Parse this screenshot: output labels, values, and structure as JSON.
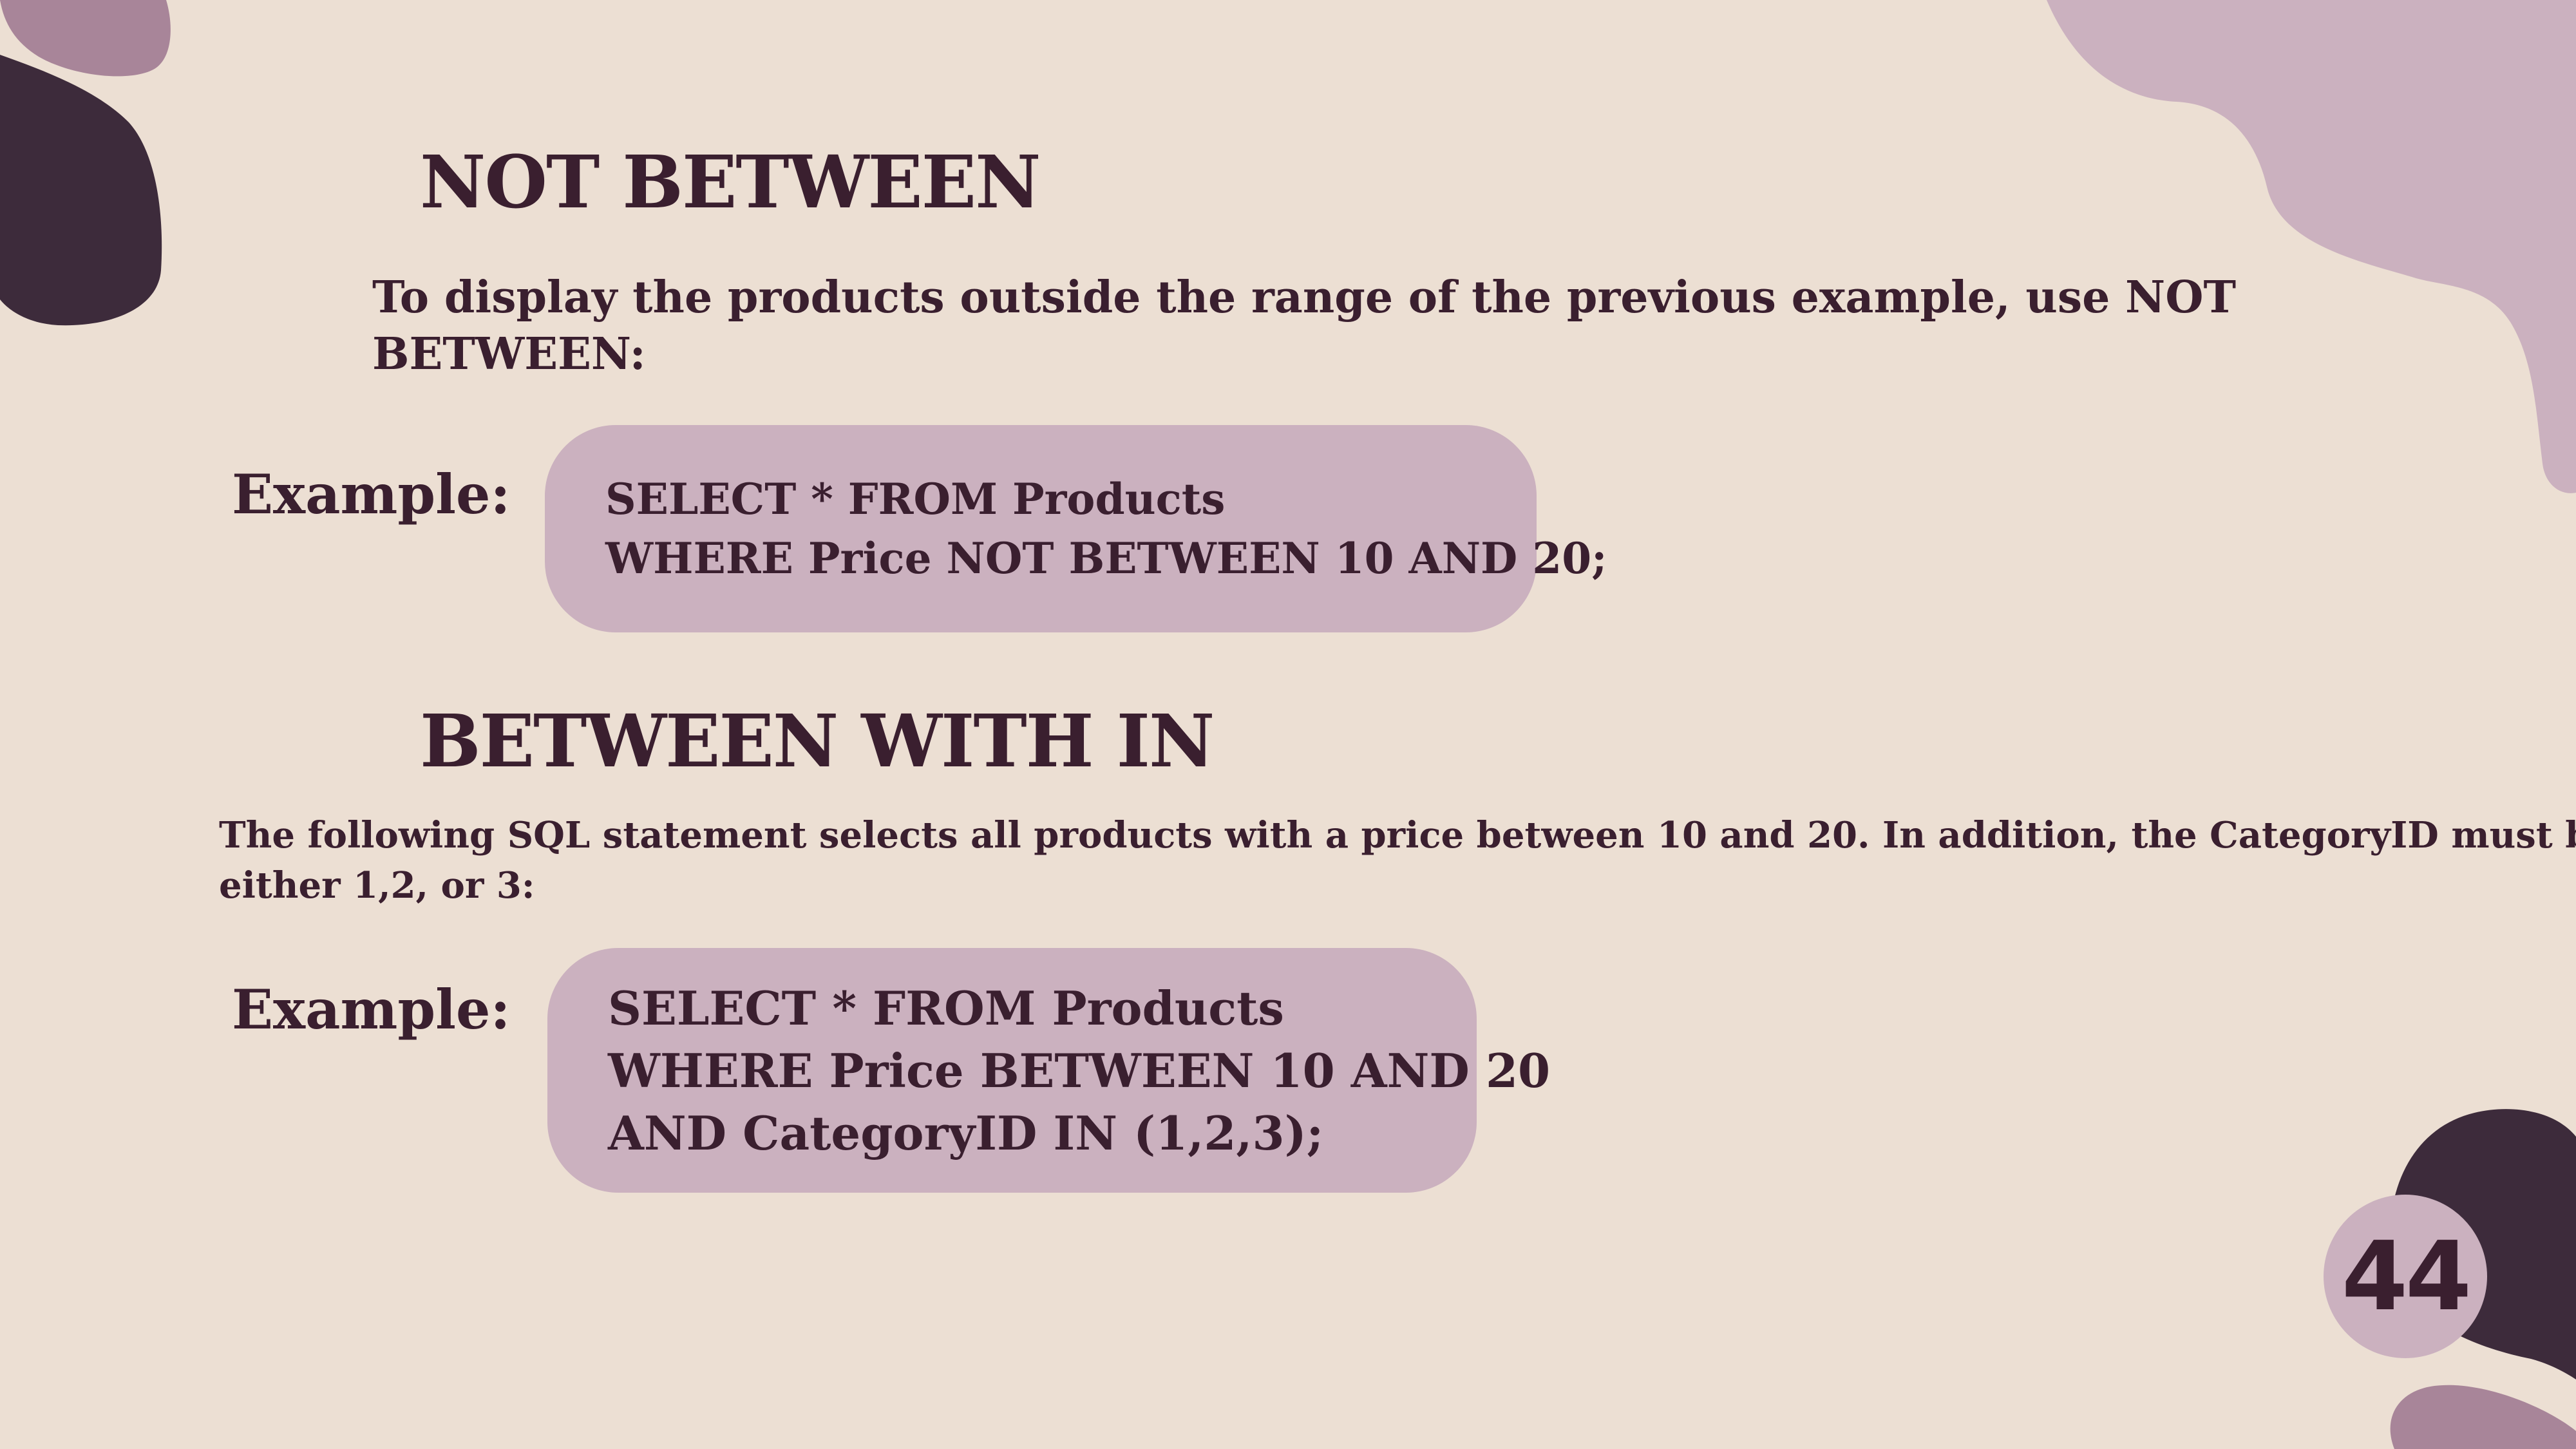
{
  "colors": {
    "background": "#ecdfd3",
    "text": "#3a1f2f",
    "code_box": "#cbb1bf",
    "blob_dark": "#3d2b3b",
    "blob_mauve": "#a88599",
    "blob_light": "#cbb1bf"
  },
  "section1": {
    "heading": "NOT BETWEEN",
    "description_line1": "To display the products outside the range of the previous example, use NOT",
    "description_line2": "BETWEEN:",
    "example_label": "Example:",
    "code": [
      "SELECT * FROM Products",
      "WHERE Price NOT BETWEEN 10 AND 20;"
    ]
  },
  "section2": {
    "heading": "BETWEEN WITH IN",
    "description_line1": "The following SQL statement selects all products with a price between 10 and 20. In addition, the CategoryID must be",
    "description_line2": "either 1,2, or 3:",
    "example_label": "Example:",
    "code": [
      "SELECT * FROM Products",
      "WHERE Price BETWEEN 10 AND 20",
      "AND CategoryID IN (1,2,3);"
    ]
  },
  "page_number": "44"
}
